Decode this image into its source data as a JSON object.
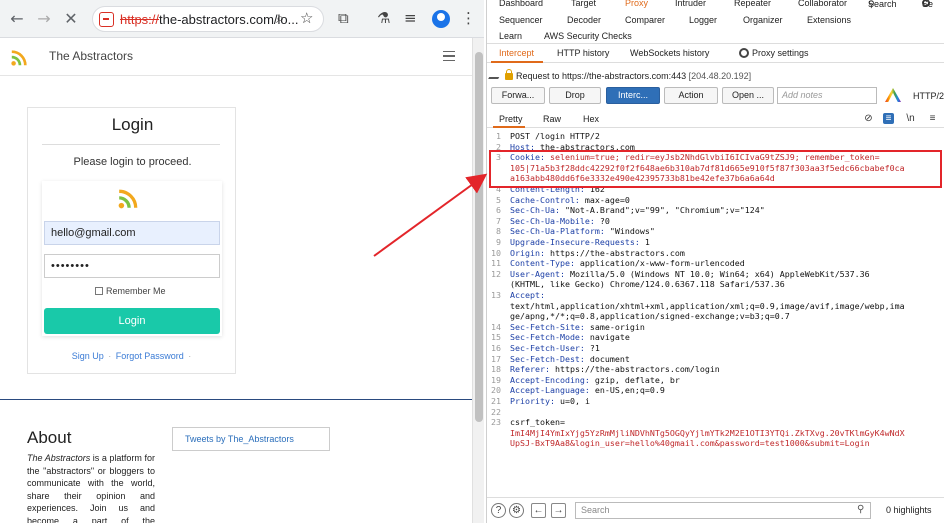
{
  "browser": {
    "url_scheme": "https://",
    "url_rest": "the-abstractors.com/lo...",
    "site_name": "The Abstractors",
    "login": {
      "title": "Login",
      "subtitle": "Please login to proceed.",
      "email_value": "hello@gmail.com",
      "password_value": "••••••••",
      "remember_label": "Remember Me",
      "button_label": "Login",
      "signup_label": "Sign Up",
      "forgot_label": "Forgot Password"
    },
    "about": {
      "title": "About",
      "text_italic": "The Abstractors",
      "text_rest": " is a platform for the \"abstractors\" or bloggers to communicate with the world, share their opinion and experiences. Join us and become a part of the community",
      "tweets_label": "Tweets by The_Abstractors"
    }
  },
  "burp": {
    "top_tabs": [
      "Dashboard",
      "Target",
      "Proxy",
      "Intruder",
      "Repeater",
      "Collaborator",
      "Search",
      "Se"
    ],
    "second_tabs": [
      "Sequencer",
      "Decoder",
      "Comparer",
      "Logger",
      "Organizer",
      "Extensions"
    ],
    "third_tabs": [
      "Learn",
      "AWS Security Checks"
    ],
    "sub_tabs": [
      "Intercept",
      "HTTP history",
      "WebSockets history",
      "Proxy settings"
    ],
    "request_label": "Request to https://the-abstractors.com:443",
    "request_ip": "[204.48.20.192]",
    "buttons": {
      "forward": "Forwa...",
      "drop": "Drop",
      "intercept": "Interc...",
      "action": "Action",
      "open": "Open ..."
    },
    "notes_placeholder": "Add notes",
    "protocol": "HTTP/2",
    "view_tabs": [
      "Pretty",
      "Raw",
      "Hex"
    ],
    "view_icons": [
      "eye-off-icon",
      "list-icon",
      "newline-icon",
      "menu-icon"
    ],
    "lines": [
      {
        "n": "1",
        "name": "",
        "val": "POST /login HTTP/2"
      },
      {
        "n": "2",
        "name": "Host:",
        "val": " the-abstractors.com"
      },
      {
        "n": "3",
        "name": "Cookie:",
        "val": " selenium=true; redir=eyJsb2NhdGlvbiI6ICIvaG9tZSJ9; remember_token=",
        "red": true
      },
      {
        "n": "",
        "name": "",
        "val": "105|71a5b3f28ddc42292f0f2f648ae6b310ab7df81d665e910f5f87f303aa3f5edc66cbabef0ca",
        "red": true
      },
      {
        "n": "",
        "name": "",
        "val": "a163abb480dd6f6e3332e490e42395733b81be42efe37b6a6a64d",
        "red": true
      },
      {
        "n": "4",
        "name": "Content-Length:",
        "val": " 162"
      },
      {
        "n": "5",
        "name": "Cache-Control:",
        "val": " max-age=0"
      },
      {
        "n": "6",
        "name": "Sec-Ch-Ua:",
        "val": " \"Not-A.Brand\";v=\"99\", \"Chromium\";v=\"124\""
      },
      {
        "n": "7",
        "name": "Sec-Ch-Ua-Mobile:",
        "val": " ?0"
      },
      {
        "n": "8",
        "name": "Sec-Ch-Ua-Platform:",
        "val": " \"Windows\""
      },
      {
        "n": "9",
        "name": "Upgrade-Insecure-Requests:",
        "val": " 1"
      },
      {
        "n": "10",
        "name": "Origin:",
        "val": " https://the-abstractors.com"
      },
      {
        "n": "11",
        "name": "Content-Type:",
        "val": " application/x-www-form-urlencoded"
      },
      {
        "n": "12",
        "name": "User-Agent:",
        "val": " Mozilla/5.0 (Windows NT 10.0; Win64; x64) AppleWebKit/537.36"
      },
      {
        "n": "",
        "name": "",
        "val": "(KHTML, like Gecko) Chrome/124.0.6367.118 Safari/537.36"
      },
      {
        "n": "13",
        "name": "Accept:",
        "val": ""
      },
      {
        "n": "",
        "name": "",
        "val": "text/html,application/xhtml+xml,application/xml;q=0.9,image/avif,image/webp,ima"
      },
      {
        "n": "",
        "name": "",
        "val": "ge/apng,*/*;q=0.8,application/signed-exchange;v=b3;q=0.7"
      },
      {
        "n": "14",
        "name": "Sec-Fetch-Site:",
        "val": " same-origin"
      },
      {
        "n": "15",
        "name": "Sec-Fetch-Mode:",
        "val": " navigate"
      },
      {
        "n": "16",
        "name": "Sec-Fetch-User:",
        "val": " ?1"
      },
      {
        "n": "17",
        "name": "Sec-Fetch-Dest:",
        "val": " document"
      },
      {
        "n": "18",
        "name": "Referer:",
        "val": " https://the-abstractors.com/login"
      },
      {
        "n": "19",
        "name": "Accept-Encoding:",
        "val": " gzip, deflate, br"
      },
      {
        "n": "20",
        "name": "Accept-Language:",
        "val": " en-US,en;q=0.9"
      },
      {
        "n": "21",
        "name": "Priority:",
        "val": " u=0, i"
      },
      {
        "n": "22",
        "name": "",
        "val": ""
      },
      {
        "n": "23",
        "name": "",
        "val": "csrf_token="
      },
      {
        "n": "",
        "name": "",
        "val": "ImI4MjI4YmIxYjg5YzRmMjliNDVhNTg5OGQyYjlmYTk2M2E1OTI3YTQi.ZkTXvg.20vTKlmGyK4wNdX",
        "red": true
      },
      {
        "n": "",
        "name": "",
        "val": "UpSJ-BxT9Aa8&login_user=hello%40gmail.com&password=test1000&submit=Login",
        "red": true
      }
    ],
    "search_placeholder": "Search",
    "highlights": "0 highlights"
  },
  "colors": {
    "accent_orange": "#e06a1a",
    "burp_blue": "#2f6fb7",
    "login_teal": "#19c9a9",
    "annotation_red": "#e3252a"
  }
}
